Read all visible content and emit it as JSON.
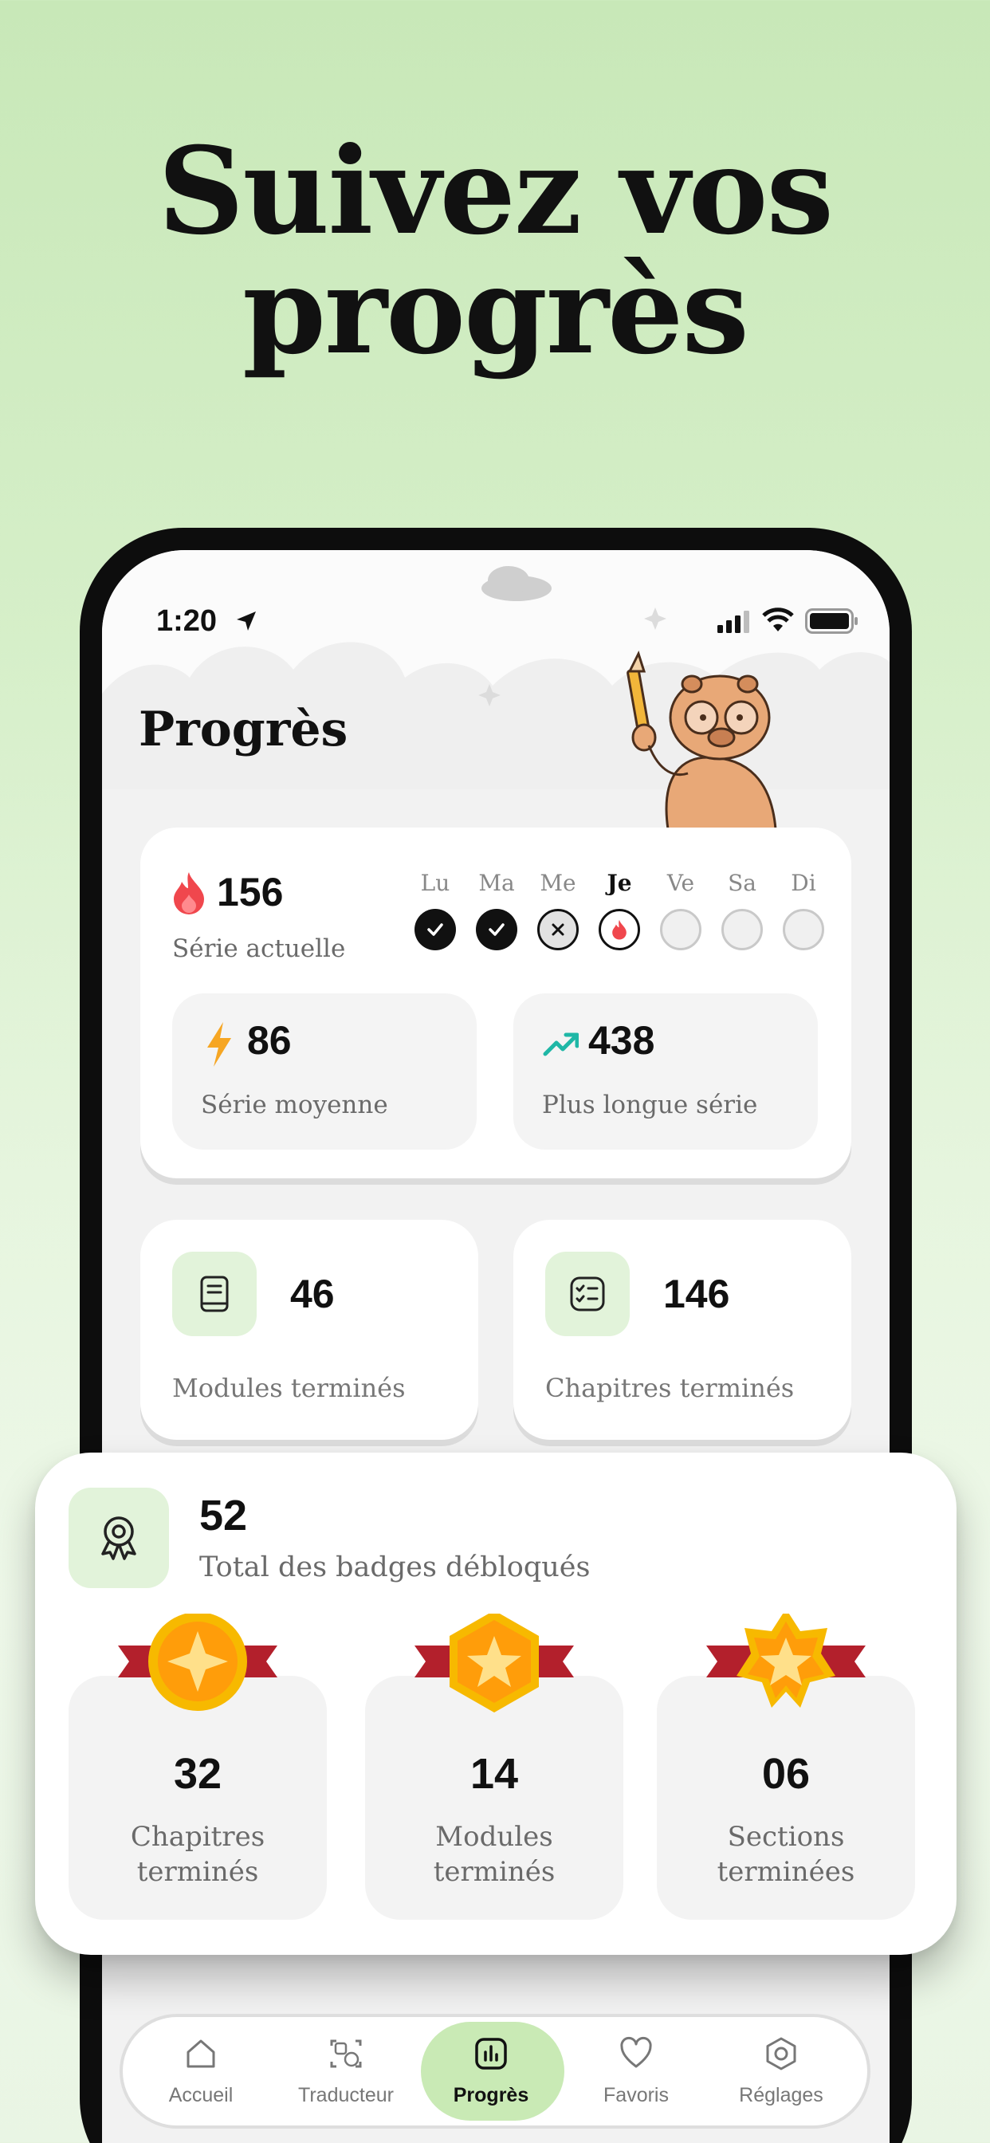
{
  "headline": {
    "line1": "Suivez vos",
    "line2": "progrès"
  },
  "status_bar": {
    "time": "1:20"
  },
  "page_title": "Progrès",
  "streak": {
    "current_value": "156",
    "current_label": "Série actuelle",
    "days": [
      {
        "label": "Lu",
        "state": "done"
      },
      {
        "label": "Ma",
        "state": "done"
      },
      {
        "label": "Me",
        "state": "missed"
      },
      {
        "label": "Je",
        "state": "today"
      },
      {
        "label": "Ve",
        "state": "empty"
      },
      {
        "label": "Sa",
        "state": "empty"
      },
      {
        "label": "Di",
        "state": "empty"
      }
    ],
    "average": {
      "value": "86",
      "label": "Série moyenne"
    },
    "longest": {
      "value": "438",
      "label": "Plus longue série"
    }
  },
  "stats": {
    "modules": {
      "value": "46",
      "label": "Modules terminés",
      "icon": "book-icon"
    },
    "chapters": {
      "value": "146",
      "label": "Chapitres terminés",
      "icon": "checklist-icon"
    }
  },
  "badges": {
    "total": "52",
    "total_label": "Total des badges débloqués",
    "items": [
      {
        "value": "32",
        "label_line1": "Chapitres",
        "label_line2": "terminés",
        "icon": "gold-medal-icon"
      },
      {
        "value": "14",
        "label_line1": "Modules",
        "label_line2": "terminés",
        "icon": "gold-hexagon-medal-icon"
      },
      {
        "value": "06",
        "label_line1": "Sections",
        "label_line2": "terminées",
        "icon": "gold-star-medal-icon"
      }
    ]
  },
  "tabbar": {
    "tabs": [
      {
        "label": "Accueil",
        "icon": "home-icon"
      },
      {
        "label": "Traducteur",
        "icon": "translate-icon"
      },
      {
        "label": "Progrès",
        "icon": "chart-icon",
        "active": true
      },
      {
        "label": "Favoris",
        "icon": "heart-icon"
      },
      {
        "label": "Réglages",
        "icon": "settings-icon"
      }
    ]
  },
  "colors": {
    "accent_green": "#c9eab5",
    "tile_green": "#e2f3da",
    "flame": "#f0474d",
    "bolt": "#f6a623",
    "trend": "#1fb7a6"
  }
}
